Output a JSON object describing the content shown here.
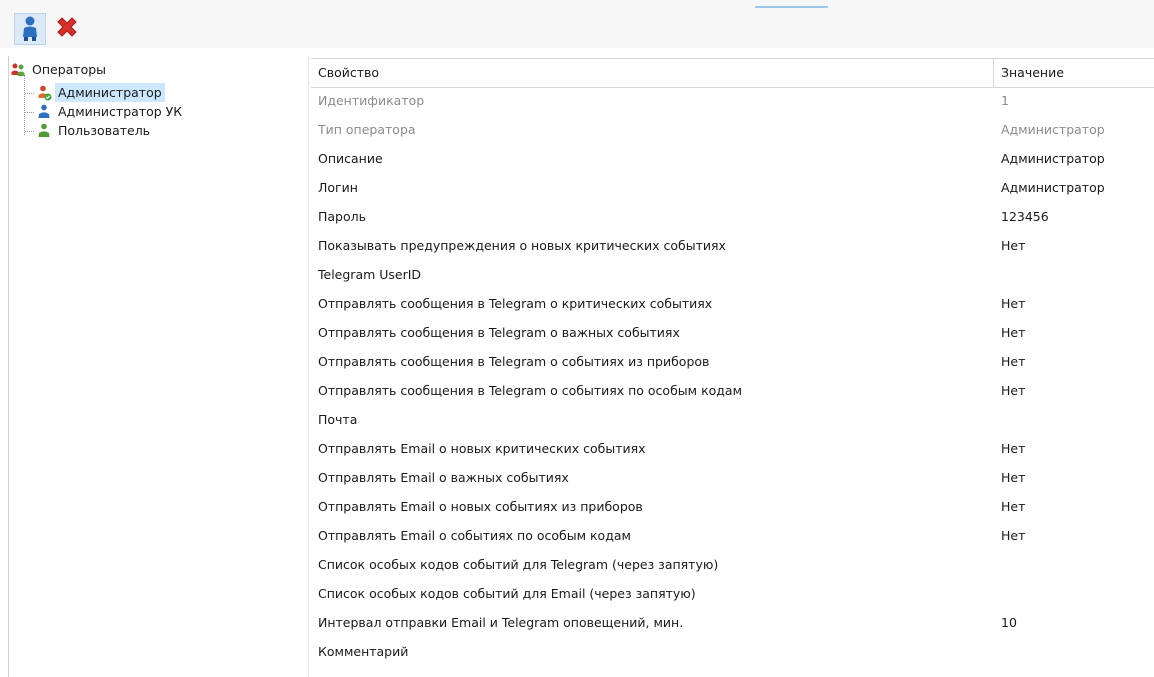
{
  "toolbar": {
    "buttons": [
      {
        "name": "add-operator-button",
        "icon": "operator-add-icon"
      },
      {
        "name": "delete-button",
        "icon": "red-x-icon"
      }
    ]
  },
  "tree": {
    "root": {
      "label": "Операторы",
      "icon": "operators-group-icon"
    },
    "items": [
      {
        "label": "Администратор",
        "icon": "admin-operator-icon",
        "selected": true
      },
      {
        "label": "Администратор УК",
        "icon": "operator-blue-icon",
        "selected": false
      },
      {
        "label": "Пользователь",
        "icon": "operator-green-icon",
        "selected": false
      }
    ]
  },
  "grid": {
    "header": {
      "property": "Свойство",
      "value": "Значение"
    },
    "rows": [
      {
        "property": "Идентификатор",
        "value": "1",
        "readonly": true
      },
      {
        "property": "Тип оператора",
        "value": "Администратор",
        "readonly": true
      },
      {
        "property": "Описание",
        "value": "Администратор"
      },
      {
        "property": "Логин",
        "value": "Администратор"
      },
      {
        "property": "Пароль",
        "value": "123456"
      },
      {
        "property": "Показывать предупреждения о новых критических событиях",
        "value": "Нет"
      },
      {
        "property": "Telegram UserID",
        "value": ""
      },
      {
        "property": "Отправлять сообщения в Telegram о критических событиях",
        "value": "Нет"
      },
      {
        "property": "Отправлять сообщения в Telegram о важных событиях",
        "value": "Нет"
      },
      {
        "property": "Отправлять сообщения в Telegram о событиях из приборов",
        "value": "Нет"
      },
      {
        "property": "Отправлять сообщения в Telegram о событиях по особым кодам",
        "value": "Нет"
      },
      {
        "property": "Почта",
        "value": ""
      },
      {
        "property": "Отправлять Email о новых критических событиях",
        "value": "Нет"
      },
      {
        "property": "Отправлять Email о важных событиях",
        "value": "Нет"
      },
      {
        "property": "Отправлять Email о новых событиях из приборов",
        "value": "Нет"
      },
      {
        "property": "Отправлять Email о событиях по особым кодам",
        "value": "Нет"
      },
      {
        "property": "Список особых кодов событий для Telegram (через запятую)",
        "value": ""
      },
      {
        "property": "Список особых кодов событий для Email (через запятую)",
        "value": ""
      },
      {
        "property": "Интервал отправки Email и Telegram оповещений, мин.",
        "value": "10"
      },
      {
        "property": "Комментарий",
        "value": ""
      }
    ]
  }
}
